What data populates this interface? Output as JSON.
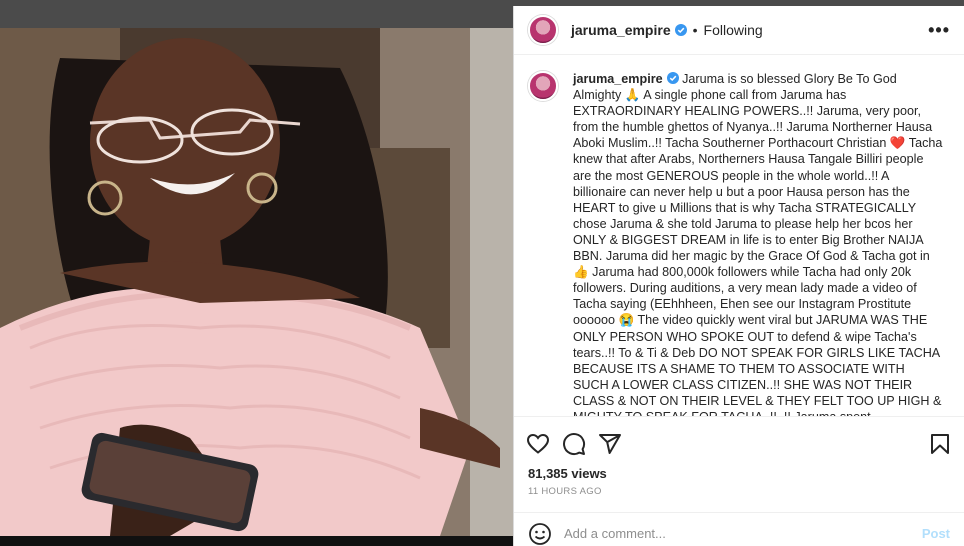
{
  "post": {
    "username": "jaruma_empire",
    "separator": "•",
    "follow_status": "Following",
    "more_label": "•••"
  },
  "caption": {
    "username": "jaruma_empire",
    "text": " Jaruma is so blessed Glory Be To God Almighty 🙏 A single phone call from Jaruma has EXTRAORDINARY HEALING POWERS..!! Jaruma, very poor, from the humble ghettos of Nyanya..!! Jaruma Northerner Hausa Aboki Muslim..!! Tacha Southerner Porthacourt Christian ❤️ Tacha knew that after Arabs, Northerners Hausa Tangale Billiri people are the most GENEROUS people in the whole world..!! A billionaire can never help u but a poor Hausa person has the HEART to give u Millions that is why Tacha STRATEGICALLY chose Jaruma & she told Jaruma to please help her bcos her ONLY & BIGGEST DREAM in life is to enter Big Brother NAIJA BBN. Jaruma did her magic by the Grace Of God & Tacha got in 👍 Jaruma had 800,000k followers while Tacha had only 20k followers. During auditions, a very mean lady made a video of Tacha saying (EEhhheen, Ehen see our Instagram Prostitute oooooo 😭 The video quickly went viral but JARUMA WAS THE ONLY PERSON WHO SPOKE OUT to defend & wipe Tacha's tears..!! To & Ti & Deb DO NOT SPEAK FOR GIRLS LIKE TACHA BECAUSE ITS A SHAME TO THEM TO ASSOCIATE WITH SUCH A LOWER CLASS CITIZEN..!! SHE WAS NOT THEIR CLASS & NOT ON THEIR LEVEL & THEY FELT TOO UP HIGH & MIGHTY TO SPEAK FOR TACHA..!!..!! Jaruma spent"
  },
  "stats": {
    "views": "81,385 views",
    "timestamp": "11 HOURS AGO"
  },
  "comment_box": {
    "placeholder": "Add a comment...",
    "post_label": "Post"
  },
  "icons": {
    "like": "heart-icon",
    "comment": "comment-icon",
    "share": "share-icon",
    "save": "bookmark-icon",
    "emoji": "emoji-icon",
    "verified": "verified-badge-icon"
  },
  "colors": {
    "verified": "#3897f0",
    "post_button": "#b2dffc",
    "timestamp": "#8e8e8e"
  }
}
